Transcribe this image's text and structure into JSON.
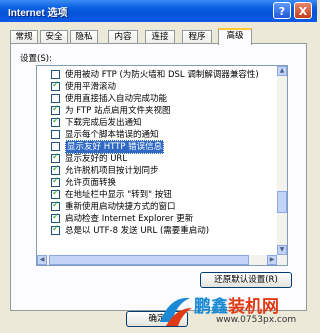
{
  "window": {
    "title": "Internet 选项",
    "help_label": "?",
    "close_label": "X"
  },
  "tabs": [
    "常规",
    "安全",
    "隐私",
    "内容",
    "连接",
    "程序",
    "高级"
  ],
  "settings_label": "设置(S):",
  "settings": [
    {
      "label": "使用被动 FTP (为防火墙和 DSL 调制解调器兼容性)",
      "checked": false
    },
    {
      "label": "使用平滑滚动",
      "checked": true
    },
    {
      "label": "使用直接插入自动完成功能",
      "checked": false
    },
    {
      "label": "为 FTP 站点启用文件夹视图",
      "checked": true
    },
    {
      "label": "下载完成后发出通知",
      "checked": true
    },
    {
      "label": "显示每个脚本错误的通知",
      "checked": false
    },
    {
      "label": "显示友好 HTTP 错误信息",
      "checked": false,
      "highlighted": true
    },
    {
      "label": "显示友好的 URL",
      "checked": true
    },
    {
      "label": "允许脱机项目按计划同步",
      "checked": true
    },
    {
      "label": "允许页面转换",
      "checked": true
    },
    {
      "label": "在地址栏中显示 \"转到\" 按钮",
      "checked": true
    },
    {
      "label": "重新使用启动快捷方式的窗口",
      "checked": true
    },
    {
      "label": "启动检查 Internet Explorer 更新",
      "checked": true
    },
    {
      "label": "总是以 UTF-8 发送 URL (需要重启动)",
      "checked": true
    }
  ],
  "restore_defaults_label": "还原默认设置(R)",
  "ok_label": "确定",
  "watermark": {
    "brand_a": "鹏鑫",
    "brand_b": "装机网",
    "url": "www.0753px.com"
  }
}
